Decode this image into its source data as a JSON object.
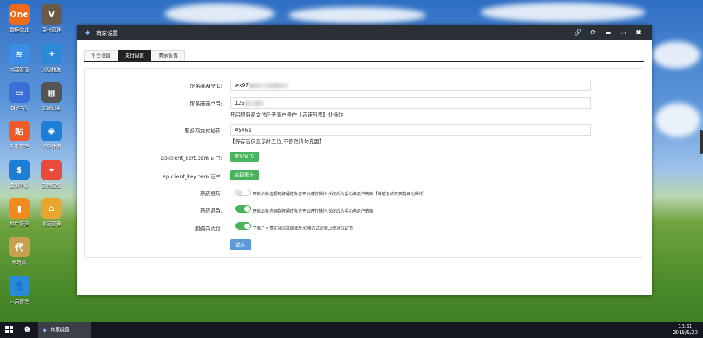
{
  "desktop": {
    "icons": [
      {
        "label": "数据商城",
        "badge": "One",
        "color": "#f06a1d"
      },
      {
        "label": "菜卡管理",
        "badge": "V",
        "color": "#6b5a4a"
      },
      {
        "label": "内容管理",
        "badge": "≋",
        "color": "#3a8ee6"
      },
      {
        "label": "消息推送",
        "badge": "✈",
        "color": "#2a8ad8"
      },
      {
        "label": "DIY中心",
        "badge": "▭",
        "color": "#3a6fd8"
      },
      {
        "label": "站点设置",
        "badge": "▦",
        "color": "#555"
      },
      {
        "label": "贴子管理",
        "badge": "贴",
        "color": "#f05a28"
      },
      {
        "label": "娱乐休闲",
        "badge": "◉",
        "color": "#1c7ed6"
      },
      {
        "label": "营销中心",
        "badge": "$",
        "color": "#1c7ed6"
      },
      {
        "label": "更换壁纸",
        "badge": "✦",
        "color": "#e84a3c"
      },
      {
        "label": "推广管理",
        "badge": "▮",
        "color": "#f08a1d"
      },
      {
        "label": "商家管理",
        "badge": "⌂",
        "color": "#e8a530"
      },
      {
        "label": "代理商",
        "badge": "代",
        "color": "#c9a050"
      },
      {
        "label": "人员管理",
        "badge": "👤",
        "color": "#2a8ad8"
      }
    ]
  },
  "window": {
    "title": "商家设置",
    "controls": {
      "link": "🔗",
      "refresh": "⟳",
      "minimize": "▬",
      "maximize": "▭",
      "close": "✖"
    }
  },
  "tabs": [
    {
      "label": "平台设置",
      "active": false
    },
    {
      "label": "支付设置",
      "active": true
    },
    {
      "label": "商家设置",
      "active": false
    }
  ],
  "form": {
    "appid_label": "服务商APPID:",
    "appid_value": "wx97",
    "mchid_label": "服务商商户号:",
    "mchid_value": "128",
    "mchid_hint": "开启服务商支付后子商户号在【店铺列表】处操作",
    "secret_label": "服务商支付秘钥:",
    "secret_value": "A5461",
    "secret_hint": "【保存后仅显示前五位,不修改请勿变更】",
    "cert_label": "apiclient_cert.pem 证书:",
    "cert_button": "变更证书",
    "key_label": "apiclient_key.pem 证书:",
    "key_button": "变更证书",
    "withdraw_label": "系统提现:",
    "withdraw_text": "开启后微信提现将通过微信平台进行操作,关闭后为手动向用户转账【当前系统不支持自动操作】",
    "withdraw_on": false,
    "refund_label": "系统退款:",
    "refund_text": "开启后微信退款将通过微信平台进行操作,关闭后为手动向用户转账",
    "refund_on": true,
    "sp_label": "服务商支付:",
    "sp_text": "子商户号请在对应店铺增改,切换方式后需上传对应证书",
    "sp_on": true,
    "submit": "提交"
  },
  "taskbar": {
    "task_label": "商家设置",
    "time": "10:51",
    "date": "2019/9/20"
  }
}
